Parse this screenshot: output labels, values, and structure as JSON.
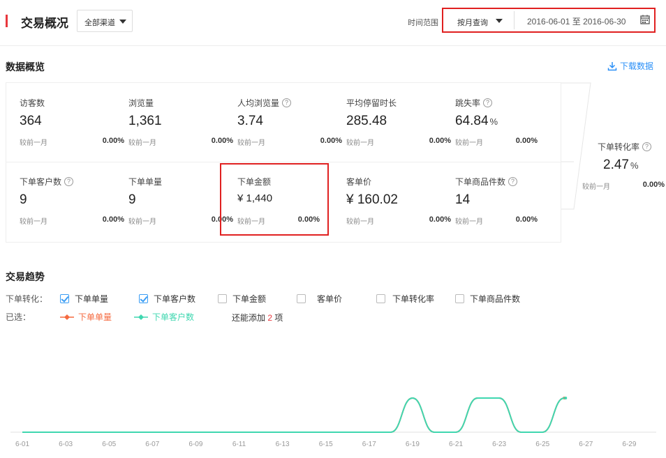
{
  "header": {
    "title": "交易概况",
    "channel": "全部渠道",
    "time_label": "时间范围",
    "query_mode": "按月查询",
    "date_start": "2016-06-01",
    "date_sep": "至",
    "date_end": "2016-06-30"
  },
  "overview": {
    "title": "数据概览",
    "download": "下载数据",
    "compare_label": "较前一月",
    "metrics_row1": [
      {
        "label": "访客数",
        "value": "364",
        "pct": "0.00%",
        "help": false
      },
      {
        "label": "浏览量",
        "value": "1,361",
        "pct": "0.00%",
        "help": false
      },
      {
        "label": "人均浏览量",
        "value": "3.74",
        "pct": "0.00%",
        "help": true
      },
      {
        "label": "平均停留时长",
        "value": "285.48",
        "pct": "0.00%",
        "help": false
      },
      {
        "label": "跳失率",
        "value": "64.84",
        "unit": "%",
        "pct": "0.00%",
        "help": true
      }
    ],
    "metrics_row2": [
      {
        "label": "下单客户数",
        "value": "9",
        "pct": "0.00%",
        "help": true
      },
      {
        "label": "下单单量",
        "value": "9",
        "pct": "0.00%",
        "help": false
      },
      {
        "label": "下单金额",
        "value": "¥ 1,440",
        "pct": "0.00%",
        "help": false
      },
      {
        "label": "客单价",
        "value": "¥ 160.02",
        "pct": "0.00%",
        "help": false
      },
      {
        "label": "下单商品件数",
        "value": "14",
        "pct": "0.00%",
        "help": true
      }
    ],
    "conversion": {
      "label": "下单转化率",
      "value": "2.47",
      "unit": "%",
      "pct": "0.00%"
    }
  },
  "trend": {
    "title": "交易趋势",
    "conv_label": "下单转化：",
    "options": [
      {
        "label": "下单单量",
        "checked": true
      },
      {
        "label": "下单客户数",
        "checked": true
      },
      {
        "label": "下单金额",
        "checked": false
      },
      {
        "label": "客单价",
        "checked": false
      },
      {
        "label": "下单转化率",
        "checked": false
      },
      {
        "label": "下单商品件数",
        "checked": false
      }
    ],
    "selected_label": "已选：",
    "selected": [
      {
        "label": "下单单量",
        "color": "#f56a3f"
      },
      {
        "label": "下单客户数",
        "color": "#3fd7b0"
      }
    ],
    "more_prefix": "还能添加",
    "more_count": "2",
    "more_suffix": "项"
  },
  "chart_data": {
    "type": "line",
    "x": [
      "6-01",
      "6-02",
      "6-03",
      "6-04",
      "6-05",
      "6-06",
      "6-07",
      "6-08",
      "6-09",
      "6-10",
      "6-11",
      "6-12",
      "6-13",
      "6-14",
      "6-15",
      "6-16",
      "6-17",
      "6-18",
      "6-19",
      "6-20",
      "6-21",
      "6-22",
      "6-23",
      "6-24",
      "6-25",
      "6-26"
    ],
    "x_tick_labels": [
      "6-01",
      "6-03",
      "6-05",
      "6-07",
      "6-09",
      "6-11",
      "6-13",
      "6-15",
      "6-17",
      "6-19",
      "6-21",
      "6-23",
      "6-25",
      "6-27",
      "6-29"
    ],
    "series": [
      {
        "name": "下单单量",
        "color": "#f56a3f",
        "values": [
          0,
          0,
          0,
          0,
          0,
          0,
          0,
          0,
          0,
          0,
          0,
          0,
          0,
          0,
          0,
          0,
          0,
          0,
          1,
          0,
          0,
          1,
          1,
          0,
          0,
          1
        ]
      },
      {
        "name": "下单客户数",
        "color": "#3fd7b0",
        "values": [
          0,
          0,
          0,
          0,
          0,
          0,
          0,
          0,
          0,
          0,
          0,
          0,
          0,
          0,
          0,
          0,
          0,
          0,
          1,
          0,
          0,
          1,
          1,
          0,
          0,
          1
        ]
      }
    ],
    "ylim": [
      0,
      1
    ]
  }
}
